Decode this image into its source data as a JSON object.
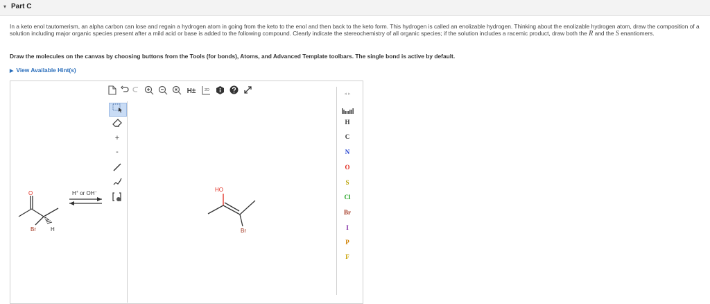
{
  "part": {
    "title": "Part C"
  },
  "question": {
    "text_1": "In a keto enol tautomerism, an alpha carbon can lose and regain a hydrogen atom in going from the keto to the enol and then back to the keto form. This hydrogen is called an enolizable hydrogen. Thinking about the enolizable hydrogen atom, draw the composition of a solution including major organic species present after a mild acid or base is added to the following compound. Clearly indicate the stereochemistry of all organic species; if the solution includes a racemic product, draw both the",
    "r_symbol": "R",
    "text_2": " and the ",
    "s_symbol": "S",
    "text_3": " enantiomers."
  },
  "instruction": "Draw the molecules on the canvas by choosing buttons from the Tools (for bonds), Atoms, and Advanced Template toolbars. The single bond is active by default.",
  "hint": {
    "label": "View Available Hint(s)"
  },
  "top_toolbar": {
    "h_toggle": "H±",
    "dimension": "2D"
  },
  "left_toolbar": {
    "charge_plus": "+",
    "charge_minus": "-"
  },
  "atoms": [
    "H",
    "C",
    "N",
    "O",
    "S",
    "Cl",
    "Br",
    "I",
    "P",
    "F"
  ],
  "atom_colors": {
    "H": "#333333",
    "C": "#333333",
    "N": "#1f3fd0",
    "O": "#e0281c",
    "S": "#b8a000",
    "Cl": "#1fa01f",
    "Br": "#a0301a",
    "I": "#7a1fa0",
    "P": "#d08000",
    "F": "#c8a000"
  },
  "structures": {
    "keto_O": "O",
    "keto_Br": "Br",
    "keto_H": "H",
    "enol_HO": "HO",
    "enol_Br": "Br",
    "conditions_main": "H",
    "conditions_plus": "+",
    "conditions_or": " or OH",
    "conditions_minus": "−"
  },
  "colors": {
    "hint_link": "#2a6ebb",
    "oxygen": "#e0281c",
    "bromine": "#a0301a",
    "active_tool": "#c9dcf5"
  }
}
